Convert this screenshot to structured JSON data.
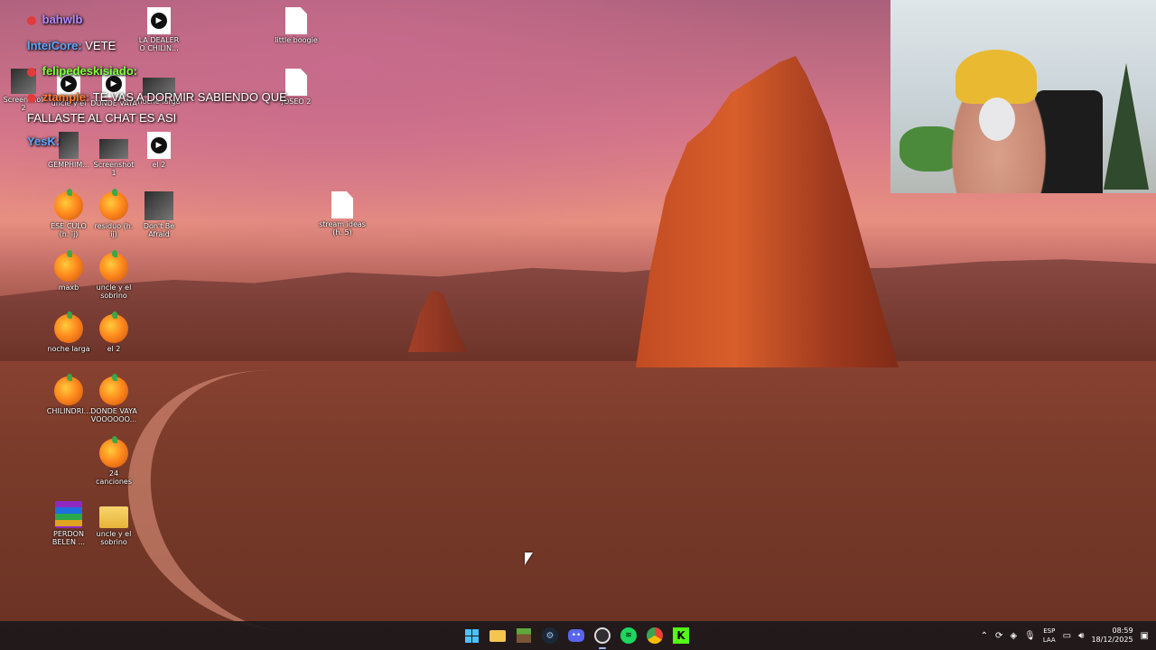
{
  "desktop": {
    "icons": [
      {
        "id": "play-1",
        "label": "",
        "icon": "video-file-icon"
      },
      {
        "id": "la-dealer",
        "label": "LA DEALER O CHILIN...",
        "icon": "video-file-icon"
      },
      {
        "id": "little-boogie",
        "label": "little boogie",
        "icon": "document-icon"
      },
      {
        "id": "screenshot-2",
        "label": "Screenshot 2",
        "icon": "image-icon"
      },
      {
        "id": "uncle-el",
        "label": "uncle y el",
        "icon": "video-file-icon"
      },
      {
        "id": "donde-vaya",
        "label": "DONDE VAYA",
        "icon": "video-file-icon"
      },
      {
        "id": "noche-larga-1",
        "label": "noche larga",
        "icon": "image-icon"
      },
      {
        "id": "joseo-2",
        "label": "JOSEO 2",
        "icon": "document-icon"
      },
      {
        "id": "screenshot-a",
        "label": "GEMPHIM...",
        "icon": "image-icon"
      },
      {
        "id": "screenshot-1",
        "label": "Screenshot 1",
        "icon": "image-icon"
      },
      {
        "id": "el-2-video",
        "label": "el 2",
        "icon": "video-file-icon"
      },
      {
        "id": "ese-culo",
        "label": "ESE CULO (h. ij)",
        "icon": "fl-studio-icon"
      },
      {
        "id": "residuo",
        "label": "residuo (h. ij)",
        "icon": "fl-studio-icon"
      },
      {
        "id": "dont-be-afraid",
        "label": "Don't Be Afraid",
        "icon": "image-icon"
      },
      {
        "id": "stream-ideas",
        "label": "stream ideas (h. 5)",
        "icon": "document-icon"
      },
      {
        "id": "maxb",
        "label": "maxb",
        "icon": "fl-studio-icon"
      },
      {
        "id": "uncle-sobrino-fl",
        "label": "uncle y el sobrino",
        "icon": "fl-studio-icon"
      },
      {
        "id": "noche-larga-2",
        "label": "noche larga",
        "icon": "fl-studio-icon"
      },
      {
        "id": "el-2-fl",
        "label": "el 2",
        "icon": "fl-studio-icon"
      },
      {
        "id": "chilindri",
        "label": "CHILINDRI...",
        "icon": "fl-studio-icon"
      },
      {
        "id": "donde-vaya-fl",
        "label": "DONDE VAYA VOOOOOO...",
        "icon": "fl-studio-icon"
      },
      {
        "id": "24-canciones",
        "label": "24 canciones",
        "icon": "fl-studio-icon"
      },
      {
        "id": "perdon-belen",
        "label": "PERDON BELEN ...",
        "icon": "winrar-icon"
      },
      {
        "id": "uncle-sobrino-folder",
        "label": "uncle y el sobrino",
        "icon": "folder-icon"
      }
    ]
  },
  "chat": {
    "messages": [
      {
        "user": "bahwlb",
        "text": "",
        "user_color": "#b48cff"
      },
      {
        "user": "InteiCore:",
        "text": "VETE",
        "user_color": "#5aa7ff"
      },
      {
        "user": "felipedeskisiado:",
        "text": "",
        "user_color": "#7dff3a"
      },
      {
        "user": "ztample:",
        "text": "TE VAS A DORMIR SABIENDO QUE",
        "user_color": "#ff7a2f"
      },
      {
        "user": "",
        "text": "FALLASTE AL CHAT ES ASI",
        "user_color": "#ffffff"
      },
      {
        "user": "YesK:",
        "text": "",
        "user_color": "#5aa7ff"
      }
    ]
  },
  "taskbar": {
    "apps": [
      {
        "name": "start",
        "icon": "windows-icon",
        "active": false
      },
      {
        "name": "file-explorer",
        "icon": "folder-icon",
        "active": false
      },
      {
        "name": "minecraft",
        "icon": "minecraft-icon",
        "active": false
      },
      {
        "name": "steam",
        "icon": "steam-icon",
        "active": false
      },
      {
        "name": "discord",
        "icon": "discord-icon",
        "active": false
      },
      {
        "name": "obs",
        "icon": "obs-icon",
        "active": true
      },
      {
        "name": "spotify",
        "icon": "spotify-icon",
        "active": false
      },
      {
        "name": "chrome",
        "icon": "chrome-icon",
        "active": false
      },
      {
        "name": "kick",
        "icon": "kick-icon",
        "active": false
      }
    ],
    "tray": {
      "lang_top": "ESP",
      "lang_bottom": "LAA",
      "time": "08:59",
      "date": "18/12/2025"
    }
  },
  "colors": {
    "taskbar_bg": "#1c181a",
    "spotify": "#1ed760",
    "kick": "#53fc18",
    "discord": "#5865f2",
    "windows": "#4cc2ff"
  }
}
